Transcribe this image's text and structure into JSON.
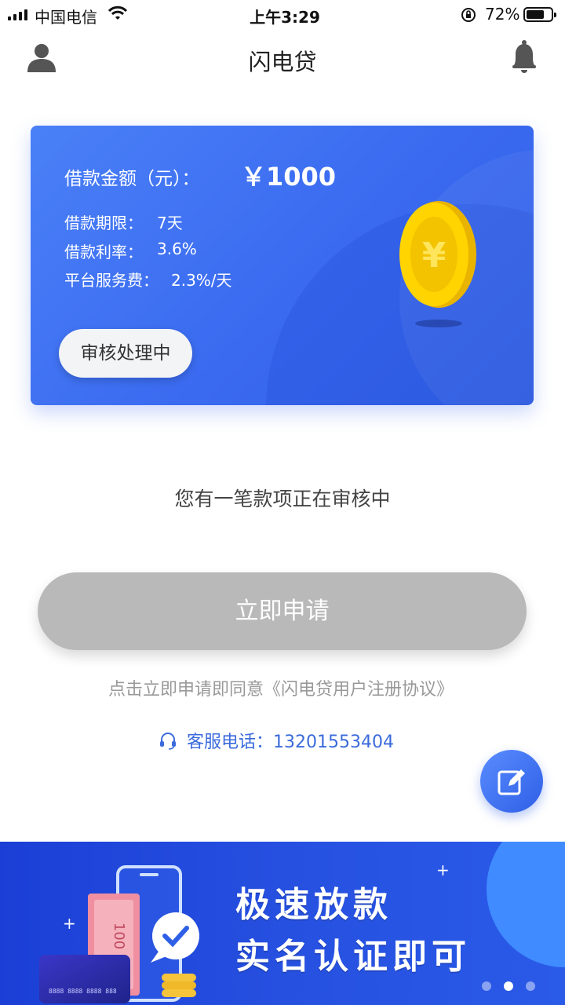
{
  "status_bar": {
    "carrier": "中国电信",
    "time": "上午3:29",
    "battery_percent": "72%",
    "battery_level": 0.72
  },
  "header": {
    "title": "闪电贷"
  },
  "loan_card": {
    "amount_label": "借款金额（元）：",
    "amount_value": "￥1000",
    "rows": [
      {
        "label": "借款期限：",
        "value": "7天"
      },
      {
        "label": "借款利率：",
        "value": "3.6%"
      },
      {
        "label": "平台服务费：",
        "value": "2.3%/天"
      }
    ],
    "status": "审核处理中",
    "coin_symbol": "¥"
  },
  "review_message": "您有一笔款项正在审核中",
  "apply_button_label": "立即申请",
  "agreement_text": "点击立即申请即同意《闪电贷用户注册协议》",
  "hotline": {
    "text": "客服电话：13201553404"
  },
  "banner": {
    "line1": "极速放款",
    "line2": "实名认证即可",
    "card_number": "8888 8888 8888 888",
    "bill_value": "100",
    "slide_count": 3,
    "active_slide": 2
  },
  "icons": {
    "user": "user-icon",
    "bell": "bell-icon",
    "headset": "headset-icon",
    "edit": "edit-icon"
  },
  "colors": {
    "primary": "#3a6af0",
    "button_disabled": "#b9b9b9",
    "hotline": "#3b6bdc"
  }
}
